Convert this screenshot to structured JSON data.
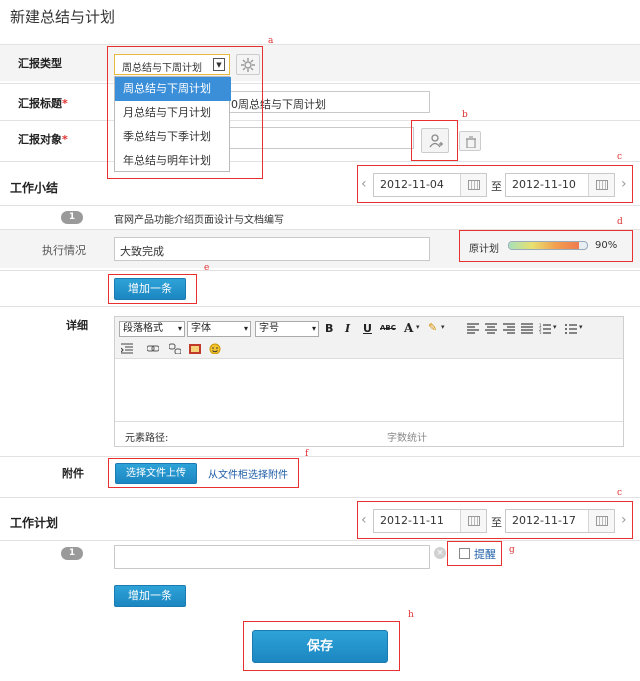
{
  "page": {
    "title": "新建总结与计划"
  },
  "report_type": {
    "label": "汇报类型",
    "selected": "周总结与下周计划",
    "options": [
      "周总结与下周计划",
      "月总结与下月计划",
      "季总结与下季计划",
      "年总结与明年计划"
    ]
  },
  "report_title": {
    "label": "汇报标题",
    "required": "*",
    "value": "0周总结与下周计划"
  },
  "report_target": {
    "label": "汇报对象",
    "required": "*"
  },
  "summary": {
    "label": "工作小结",
    "date_from": "2012-11-04",
    "date_sep": "至",
    "date_to": "2012-11-10",
    "items": [
      {
        "num": "1",
        "text": "官网产品功能介绍页面设计与文档编写",
        "status_label": "执行情况",
        "status_value": "大致完成",
        "plan_label": "原计划",
        "plan_percent": "90%",
        "plan_fraction": 0.9
      }
    ],
    "add_button": "增加一条"
  },
  "detail": {
    "label": "详细",
    "toolbar": {
      "paragraph": "段落格式",
      "font": "字体",
      "size": "字号",
      "bold": "B",
      "italic": "I",
      "underline": "U",
      "strike": "ABC",
      "fontcolor": "A"
    },
    "path_label": "元素路径:",
    "word_count": "字数统计"
  },
  "attachment": {
    "label": "附件",
    "upload_button": "选择文件上传",
    "cabinet_link": "从文件柜选择附件"
  },
  "plan": {
    "label": "工作计划",
    "date_from": "2012-11-11",
    "date_sep": "至",
    "date_to": "2012-11-17",
    "items": [
      {
        "num": "1",
        "value": "",
        "remind_label": "提醒"
      }
    ],
    "add_button": "增加一条"
  },
  "save_button": "保存",
  "annotations": {
    "a": "a",
    "b": "b",
    "c1": "c",
    "c2": "c",
    "d": "d",
    "e": "e",
    "f": "f",
    "g": "g",
    "h": "h"
  },
  "colors": {
    "accent": "#1c86c1",
    "annotation": "#e8302f",
    "dropdown_highlight": "#3b8fd8",
    "required": "#e03030"
  }
}
